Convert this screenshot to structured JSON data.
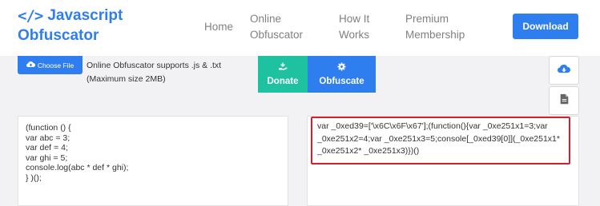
{
  "brand": {
    "icon": "</>",
    "line1": "Javascript",
    "line2": "Obfuscator"
  },
  "nav": {
    "home": "Home",
    "online_line1": "Online",
    "online_line2": "Obfuscator",
    "how_line1": "How It",
    "how_line2": "Works",
    "premium_line1": "Premium",
    "premium_line2": "Membership",
    "download": "Download"
  },
  "upload": {
    "choose_file": "Choose File",
    "note_line1": "Online Obfuscator supports .js & .txt",
    "note_line2": "(Maximum size 2MB)"
  },
  "actions": {
    "donate": "Donate",
    "obfuscate": "Obfuscate"
  },
  "icons": {
    "logo": "code-brackets-icon",
    "choose_file": "cloud-upload-icon",
    "donate": "hand-donate-icon",
    "obfuscate": "gear-icon",
    "side_download": "cloud-download-icon",
    "side_file": "file-icon"
  },
  "colors": {
    "primary": "#2f7ef0",
    "donate": "#1ec1a0",
    "highlight": "#d3202a"
  },
  "input_code": [
    "(function () {",
    "var abc = 3;",
    "var def = 4;",
    "var ghi = 5;",
    "console.log(abc * def * ghi);",
    "} )();"
  ],
  "output_code": [
    "var _0xed39=['\\x6C\\x6F\\x67'];(function(){var _0xe251x1=3;var",
    "_0xe251x2=4;var _0xe251x3=5;console[_0xed39[0]](_0xe251x1*",
    "_0xe251x2* _0xe251x3)})()"
  ]
}
